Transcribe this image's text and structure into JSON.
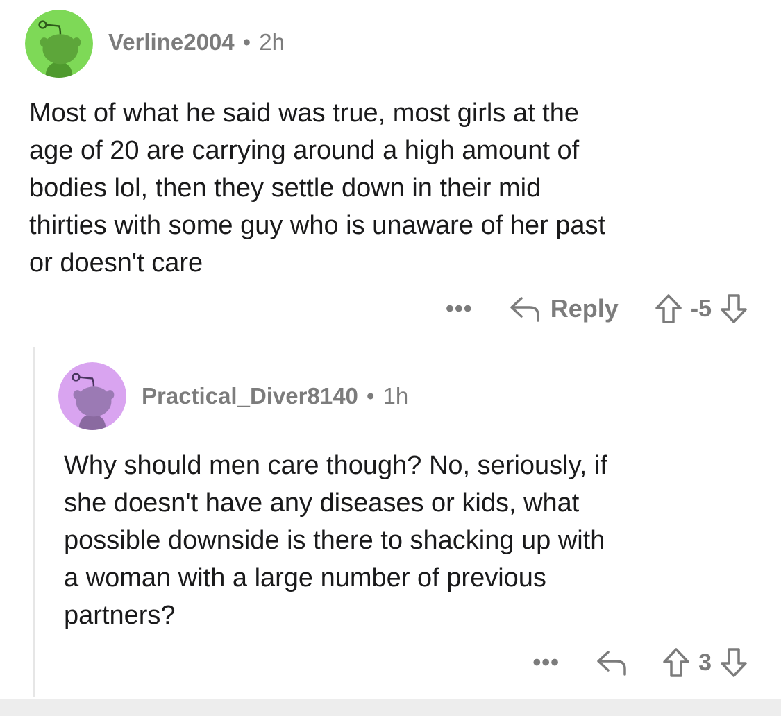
{
  "comments": [
    {
      "username": "Verline2004",
      "separator": "•",
      "time": "2h",
      "avatar_color": "#7ed957",
      "body": "Most of what he said was true, most girls at the\nage of 20 are carrying around a high amount of\nbodies lol, then they settle down in their mid\nthirties with some guy who is unaware of her past\nor doesn't care",
      "more_label": "•••",
      "reply_label": "Reply",
      "score": "-5"
    },
    {
      "username": "Practical_Diver8140",
      "separator": "•",
      "time": "1h",
      "avatar_color": "#d9a4f0",
      "body": "Why should men care though? No, seriously, if\nshe doesn't have any diseases or kids, what\npossible downside is there to shacking up with\na woman with a large number of previous\npartners?",
      "more_label": "•••",
      "score": "3"
    }
  ],
  "icons": {
    "avatar": "reddit-snoo-avatar-icon",
    "reply": "reply-arrow-icon",
    "upvote": "upvote-arrow-icon",
    "downvote": "downvote-arrow-icon"
  }
}
